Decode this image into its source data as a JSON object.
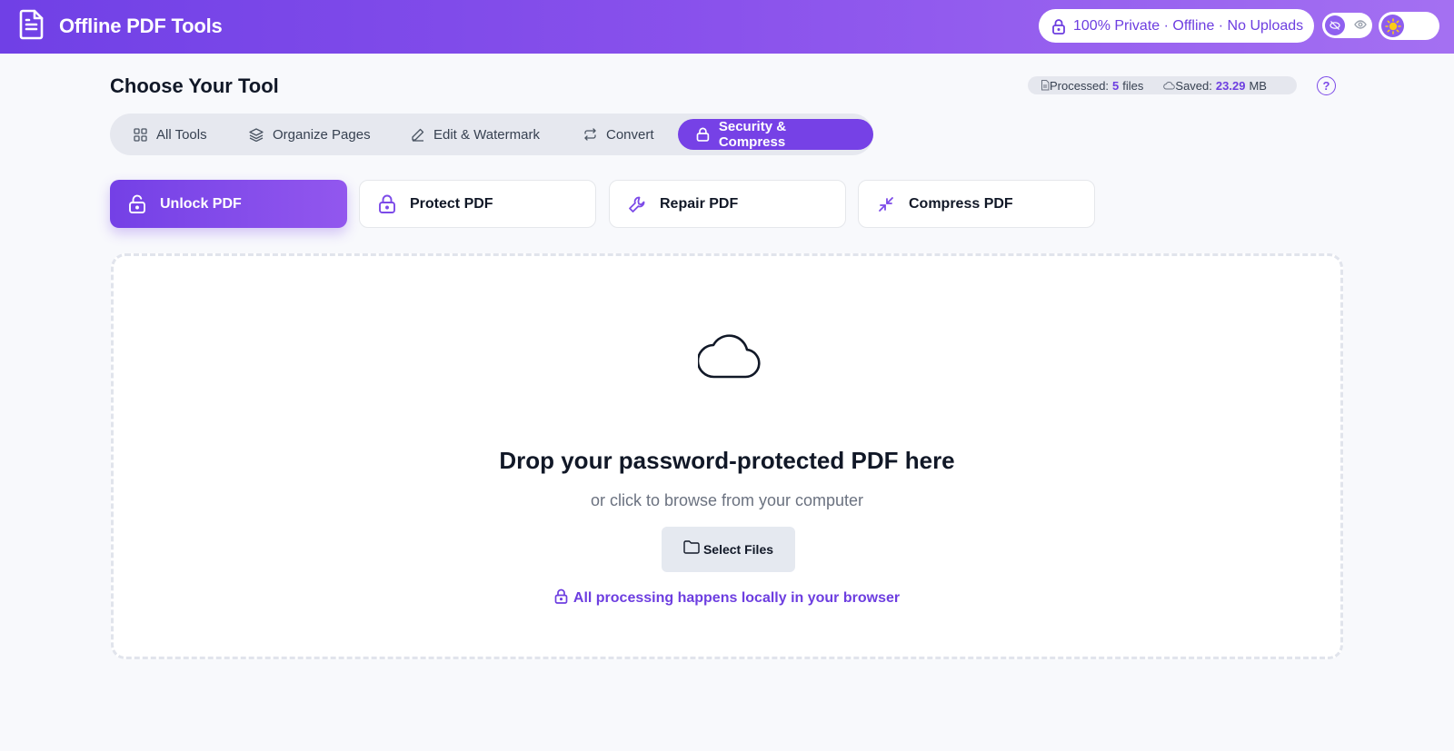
{
  "header": {
    "app_title": "Offline PDF Tools",
    "privacy_badge": "100% Private · Offline · No Uploads",
    "accent": "#7c4ae8"
  },
  "section": {
    "title": "Choose Your Tool"
  },
  "stats": {
    "processed_label": "Processed:",
    "processed_count": "5",
    "processed_unit": "files",
    "saved_label": "Saved:",
    "saved_value": "23.29",
    "saved_unit": "MB"
  },
  "help": {
    "label": "?"
  },
  "tabs": [
    {
      "label": "All Tools",
      "icon": "grid-icon",
      "active": false
    },
    {
      "label": "Organize Pages",
      "icon": "layers-icon",
      "active": false
    },
    {
      "label": "Edit & Watermark",
      "icon": "pencil-icon",
      "active": false
    },
    {
      "label": "Convert",
      "icon": "repeat-icon",
      "active": false
    },
    {
      "label": "Security & Compress",
      "icon": "lock-icon",
      "active": true
    }
  ],
  "tools": [
    {
      "label": "Unlock PDF",
      "icon": "unlock-icon",
      "active": true
    },
    {
      "label": "Protect PDF",
      "icon": "lock-icon",
      "active": false
    },
    {
      "label": "Repair PDF",
      "icon": "wrench-icon",
      "active": false
    },
    {
      "label": "Compress PDF",
      "icon": "compress-icon",
      "active": false
    }
  ],
  "dropzone": {
    "title": "Drop your password-protected PDF here",
    "subtitle": "or click to browse from your computer",
    "button_label": "Select Files",
    "note": "All processing happens locally in your browser"
  }
}
